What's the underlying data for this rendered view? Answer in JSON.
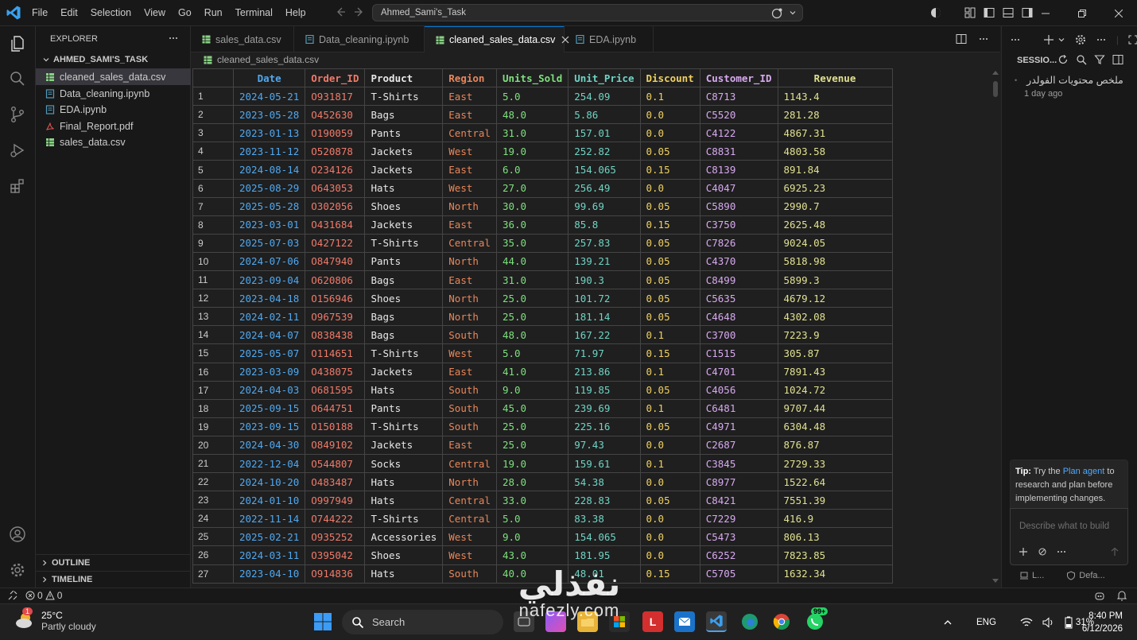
{
  "menu": [
    "File",
    "Edit",
    "Selection",
    "View",
    "Go",
    "Run",
    "Terminal",
    "Help"
  ],
  "command_center": "Ahmed_Sami's_Task",
  "explorer": {
    "title": "EXPLORER",
    "folder": "AHMED_SAMI'S_TASK",
    "files": [
      {
        "name": "cleaned_sales_data.csv",
        "type": "csv",
        "active": true
      },
      {
        "name": "Data_cleaning.ipynb",
        "type": "ipynb",
        "active": false
      },
      {
        "name": "EDA.ipynb",
        "type": "ipynb",
        "active": false
      },
      {
        "name": "Final_Report.pdf",
        "type": "pdf",
        "active": false
      },
      {
        "name": "sales_data.csv",
        "type": "csv",
        "active": false
      }
    ],
    "outline": "OUTLINE",
    "timeline": "TIMELINE"
  },
  "tabs": [
    {
      "label": "sales_data.csv",
      "type": "csv"
    },
    {
      "label": "Data_cleaning.ipynb",
      "type": "ipynb"
    },
    {
      "label": "cleaned_sales_data.csv",
      "type": "csv",
      "active": true
    },
    {
      "label": "EDA.ipynb",
      "type": "ipynb"
    }
  ],
  "breadcrumb": "cleaned_sales_data.csv",
  "table": {
    "columns": [
      {
        "name": "Date",
        "color": "#4fa8f0",
        "align": "center"
      },
      {
        "name": "Order_ID",
        "color": "#f07a6a",
        "align": "left"
      },
      {
        "name": "Product",
        "color": "#e8e8e8",
        "align": "left"
      },
      {
        "name": "Region",
        "color": "#e8875a",
        "align": "left"
      },
      {
        "name": "Units_Sold",
        "color": "#7ee07e",
        "align": "left"
      },
      {
        "name": "Unit_Price",
        "color": "#6fd3c4",
        "align": "left"
      },
      {
        "name": "Discount",
        "color": "#f0d060",
        "align": "left"
      },
      {
        "name": "Customer_ID",
        "color": "#d7a9f0",
        "align": "left"
      },
      {
        "name": "Revenue",
        "color": "#e0e090",
        "align": "center"
      }
    ],
    "rows": [
      [
        "1",
        "2024-05-21",
        "O931817",
        "T-Shirts",
        "East",
        "5.0",
        "254.09",
        "0.1",
        "C8713",
        "1143.4"
      ],
      [
        "2",
        "2023-05-28",
        "O452630",
        "Bags",
        "East",
        "48.0",
        "5.86",
        "0.0",
        "C5520",
        "281.28"
      ],
      [
        "3",
        "2023-01-13",
        "O190059",
        "Pants",
        "Central",
        "31.0",
        "157.01",
        "0.0",
        "C4122",
        "4867.31"
      ],
      [
        "4",
        "2023-11-12",
        "O520878",
        "Jackets",
        "West",
        "19.0",
        "252.82",
        "0.05",
        "C8831",
        "4803.58"
      ],
      [
        "5",
        "2024-08-14",
        "O234126",
        "Jackets",
        "East",
        "6.0",
        "154.065",
        "0.15",
        "C8139",
        "891.84"
      ],
      [
        "6",
        "2025-08-29",
        "O643053",
        "Hats",
        "West",
        "27.0",
        "256.49",
        "0.0",
        "C4047",
        "6925.23"
      ],
      [
        "7",
        "2025-05-28",
        "O302056",
        "Shoes",
        "North",
        "30.0",
        "99.69",
        "0.05",
        "C5890",
        "2990.7"
      ],
      [
        "8",
        "2023-03-01",
        "O431684",
        "Jackets",
        "East",
        "36.0",
        "85.8",
        "0.15",
        "C3750",
        "2625.48"
      ],
      [
        "9",
        "2025-07-03",
        "O427122",
        "T-Shirts",
        "Central",
        "35.0",
        "257.83",
        "0.05",
        "C7826",
        "9024.05"
      ],
      [
        "10",
        "2024-07-06",
        "O847940",
        "Pants",
        "North",
        "44.0",
        "139.21",
        "0.05",
        "C4370",
        "5818.98"
      ],
      [
        "11",
        "2023-09-04",
        "O620806",
        "Bags",
        "East",
        "31.0",
        "190.3",
        "0.05",
        "C8499",
        "5899.3"
      ],
      [
        "12",
        "2023-04-18",
        "O156946",
        "Shoes",
        "North",
        "25.0",
        "101.72",
        "0.05",
        "C5635",
        "4679.12"
      ],
      [
        "13",
        "2024-02-11",
        "O967539",
        "Bags",
        "North",
        "25.0",
        "181.14",
        "0.05",
        "C4648",
        "4302.08"
      ],
      [
        "14",
        "2024-04-07",
        "O838438",
        "Bags",
        "South",
        "48.0",
        "167.22",
        "0.1",
        "C3700",
        "7223.9"
      ],
      [
        "15",
        "2025-05-07",
        "O114651",
        "T-Shirts",
        "West",
        "5.0",
        "71.97",
        "0.15",
        "C1515",
        "305.87"
      ],
      [
        "16",
        "2023-03-09",
        "O438075",
        "Jackets",
        "East",
        "41.0",
        "213.86",
        "0.1",
        "C4701",
        "7891.43"
      ],
      [
        "17",
        "2024-04-03",
        "O681595",
        "Hats",
        "South",
        "9.0",
        "119.85",
        "0.05",
        "C4056",
        "1024.72"
      ],
      [
        "18",
        "2025-09-15",
        "O644751",
        "Pants",
        "South",
        "45.0",
        "239.69",
        "0.1",
        "C6481",
        "9707.44"
      ],
      [
        "19",
        "2023-09-15",
        "O150188",
        "T-Shirts",
        "South",
        "25.0",
        "225.16",
        "0.05",
        "C4971",
        "6304.48"
      ],
      [
        "20",
        "2024-04-30",
        "O849102",
        "Jackets",
        "East",
        "25.0",
        "97.43",
        "0.0",
        "C2687",
        "876.87"
      ],
      [
        "21",
        "2022-12-04",
        "O544807",
        "Socks",
        "Central",
        "19.0",
        "159.61",
        "0.1",
        "C3845",
        "2729.33"
      ],
      [
        "22",
        "2024-10-20",
        "O483487",
        "Hats",
        "North",
        "28.0",
        "54.38",
        "0.0",
        "C8977",
        "1522.64"
      ],
      [
        "23",
        "2024-01-10",
        "O997949",
        "Hats",
        "Central",
        "33.0",
        "228.83",
        "0.05",
        "C8421",
        "7551.39"
      ],
      [
        "24",
        "2022-11-14",
        "O744222",
        "T-Shirts",
        "Central",
        "5.0",
        "83.38",
        "0.0",
        "C7229",
        "416.9"
      ],
      [
        "25",
        "2025-02-21",
        "O935252",
        "Accessories",
        "West",
        "9.0",
        "154.065",
        "0.0",
        "C5473",
        "806.13"
      ],
      [
        "26",
        "2024-03-11",
        "O395042",
        "Shoes",
        "West",
        "43.0",
        "181.95",
        "0.0",
        "C6252",
        "7823.85"
      ],
      [
        "27",
        "2023-04-10",
        "O914836",
        "Hats",
        "South",
        "40.0",
        "48.01",
        "0.15",
        "C5705",
        "1632.34"
      ]
    ]
  },
  "chat": {
    "sessions_title": "SESSIO...",
    "session_name": "ملخص محتويات الفولدر",
    "session_time": "1 day ago",
    "tip_prefix": "Tip:",
    "tip_pre": " Try the ",
    "tip_link": "Plan agent",
    "tip_post": " to research and plan before implementing changes.",
    "input_placeholder": "Describe what to build",
    "bottom_left": "L...",
    "bottom_right": "Defa..."
  },
  "status": {
    "errors": "0",
    "warnings": "0"
  },
  "taskbar": {
    "temp": "25°C",
    "weather": "Partly cloudy",
    "weather_badge": "1",
    "search": "Search",
    "lang": "ENG",
    "battery": "31%",
    "time": "8:40 PM",
    "date": "6/12/2026",
    "whatsapp_badge": "99+"
  },
  "watermark": {
    "arabic": "نفذلي",
    "latin": "nafezly.com"
  },
  "colors": {
    "accent": "#0078d4",
    "csv_icon": "#89d185",
    "ipynb_icon": "#519aba",
    "pdf_icon": "#e05252"
  }
}
